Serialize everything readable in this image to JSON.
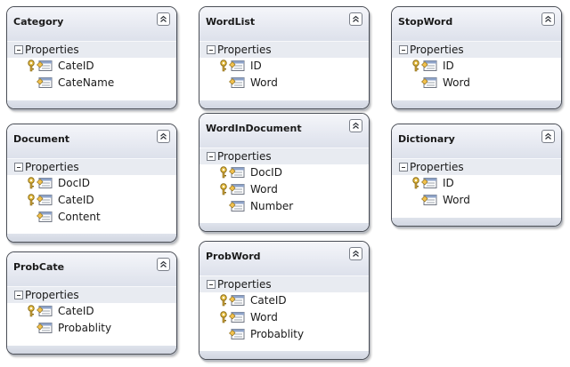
{
  "colors": {
    "header": "#e6e9f1",
    "border": "#4a4e56",
    "key": "#c8a13b"
  },
  "section_label": "Properties",
  "entities": {
    "category": {
      "title": "Category",
      "props": [
        {
          "name": "CateID",
          "key": true
        },
        {
          "name": "CateName",
          "key": false
        }
      ]
    },
    "wordlist": {
      "title": "WordList",
      "props": [
        {
          "name": "ID",
          "key": true
        },
        {
          "name": "Word",
          "key": false
        }
      ]
    },
    "stopword": {
      "title": "StopWord",
      "props": [
        {
          "name": "ID",
          "key": true
        },
        {
          "name": "Word",
          "key": false
        }
      ]
    },
    "document": {
      "title": "Document",
      "props": [
        {
          "name": "DocID",
          "key": true
        },
        {
          "name": "CateID",
          "key": true
        },
        {
          "name": "Content",
          "key": false
        }
      ]
    },
    "wordindocument": {
      "title": "WordInDocument",
      "props": [
        {
          "name": "DocID",
          "key": true
        },
        {
          "name": "Word",
          "key": true
        },
        {
          "name": "Number",
          "key": false
        }
      ]
    },
    "dictionary": {
      "title": "Dictionary",
      "props": [
        {
          "name": "ID",
          "key": true
        },
        {
          "name": "Word",
          "key": false
        }
      ]
    },
    "probcate": {
      "title": "ProbCate",
      "props": [
        {
          "name": "CateID",
          "key": true
        },
        {
          "name": "Probablity",
          "key": false
        }
      ]
    },
    "probword": {
      "title": "ProbWord",
      "props": [
        {
          "name": "CateID",
          "key": true
        },
        {
          "name": "Word",
          "key": true
        },
        {
          "name": "Probablity",
          "key": false
        }
      ]
    }
  },
  "icons": {
    "collapse": "double-chevron-up-icon",
    "key": "key-icon",
    "property": "property-icon",
    "toggle": "minus-icon"
  }
}
